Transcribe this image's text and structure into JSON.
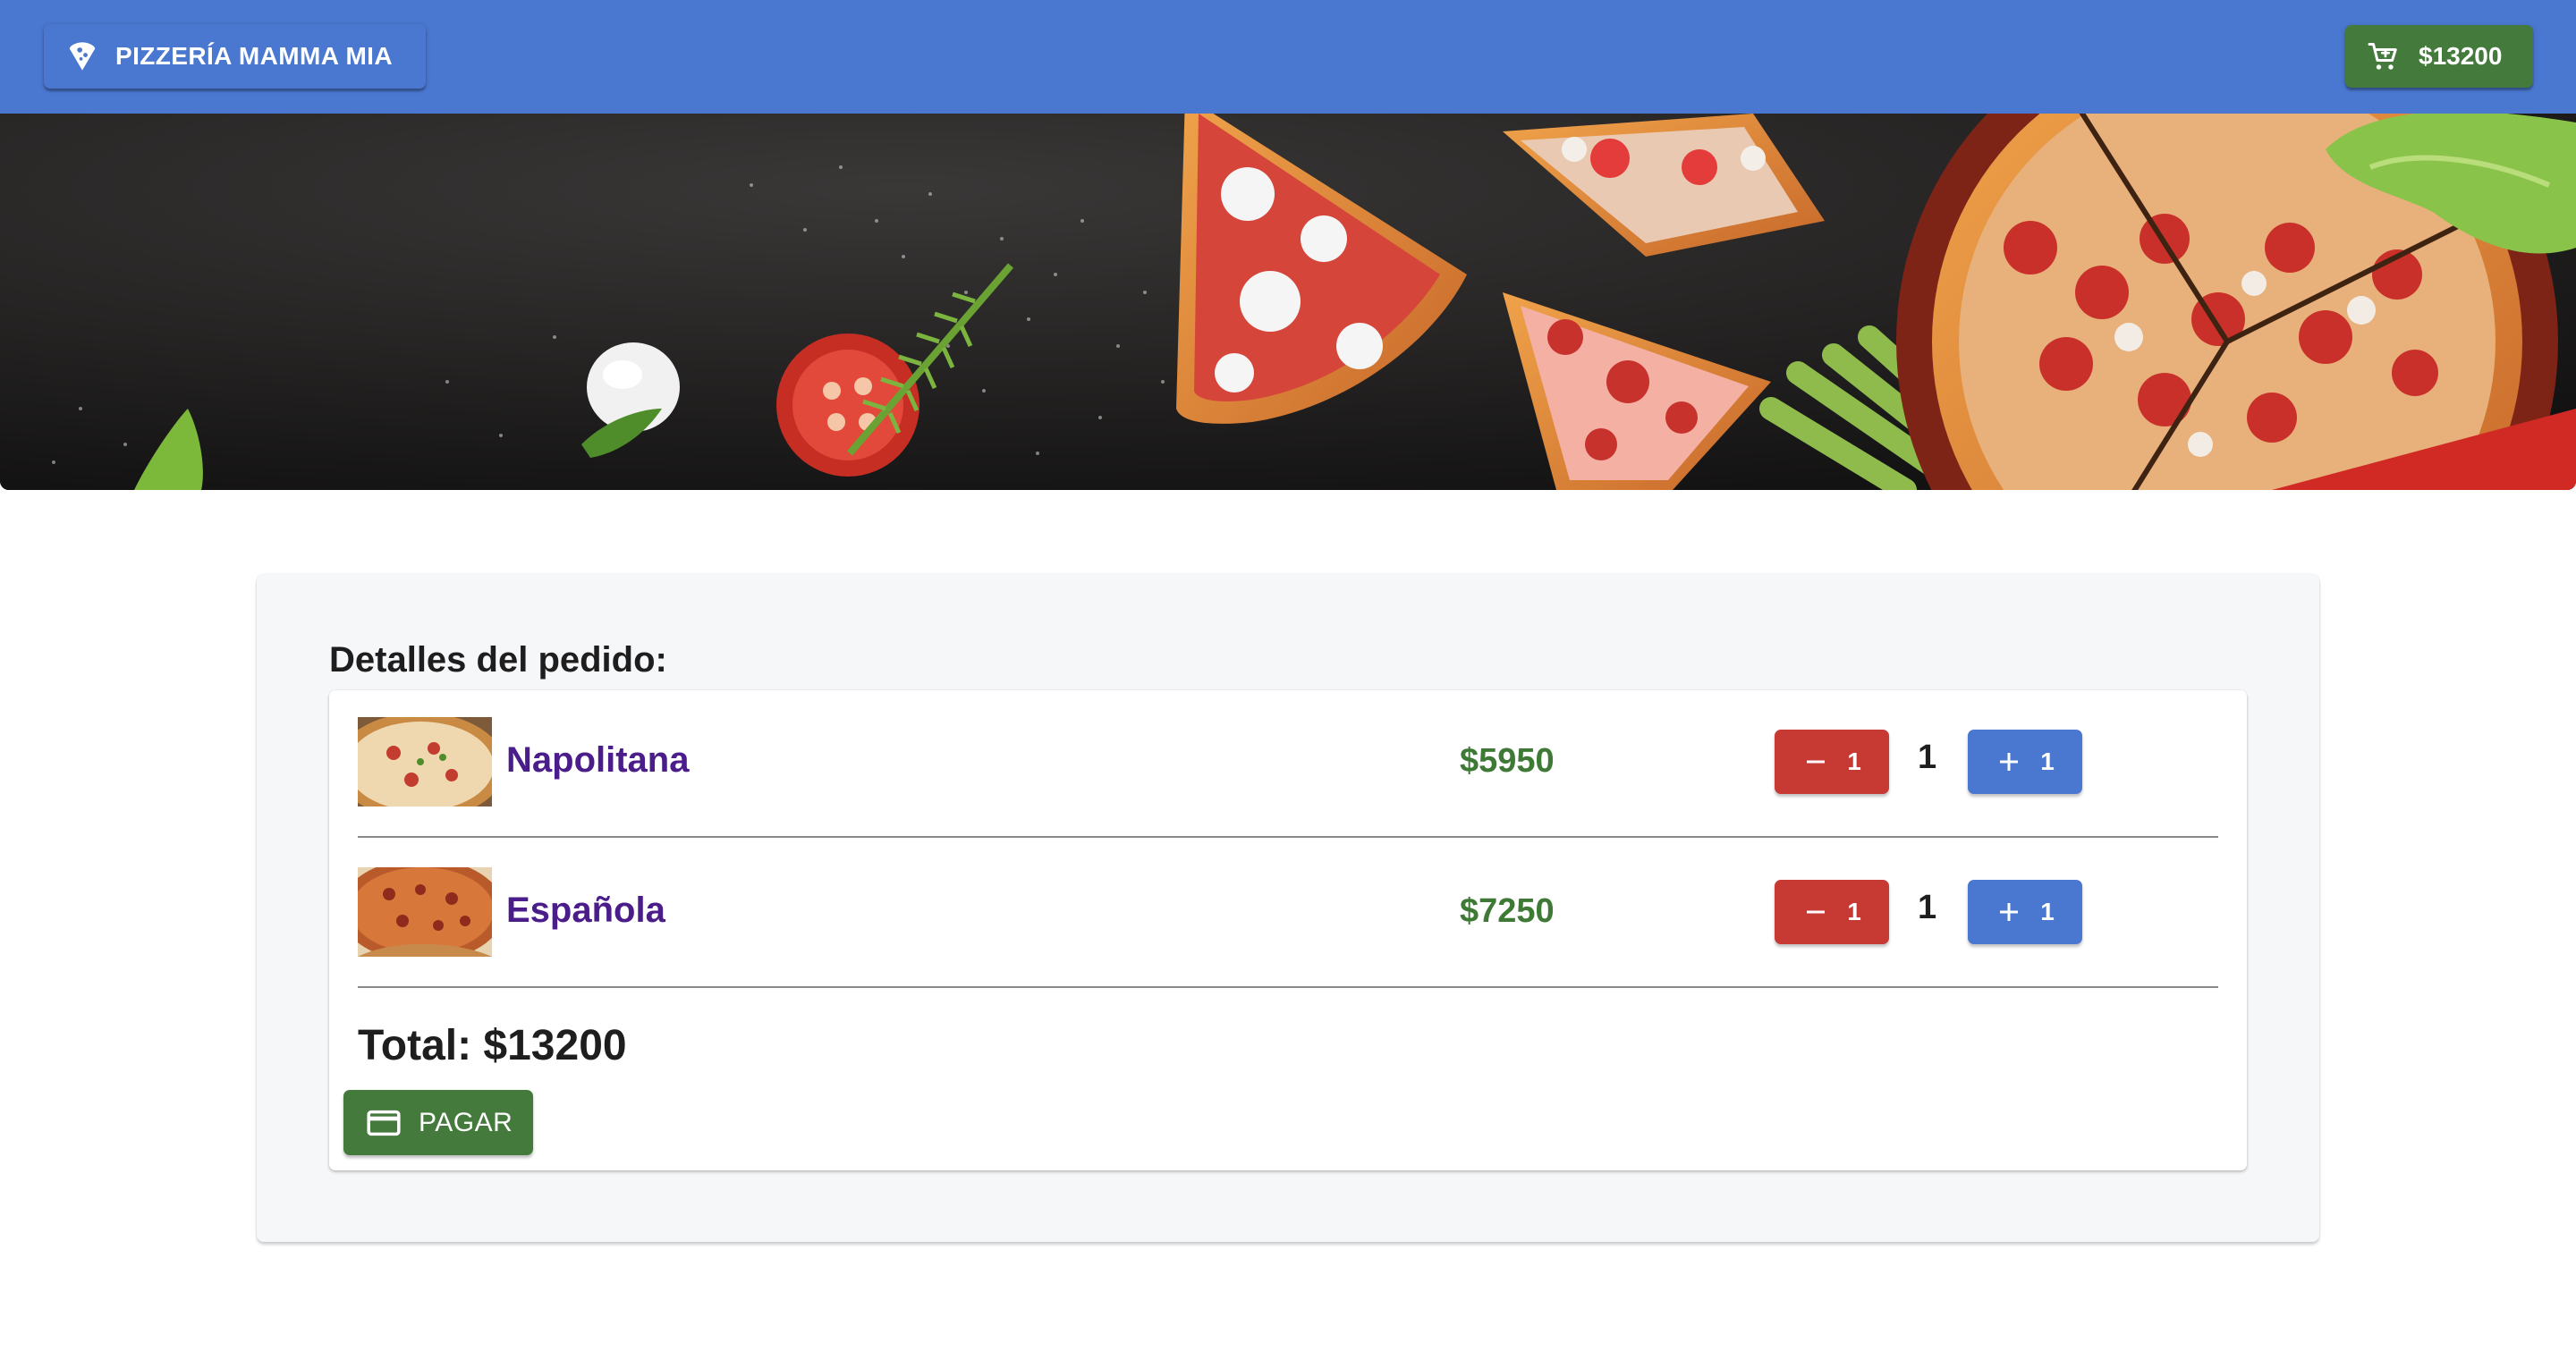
{
  "header": {
    "brand_label": "PIZZERÍA MAMMA MIA",
    "brand_icon": "pizza-slice-icon",
    "cart_icon": "cart-icon",
    "cart_total": "$13200",
    "bar_color": "#4a77cf",
    "cart_color": "#447a3c"
  },
  "hero": {
    "image": "pizza-banner"
  },
  "order": {
    "heading": "Detalles del pedido:",
    "items": [
      {
        "name": "Napolitana",
        "price": "$5950",
        "quantity": "1",
        "decrement_label": "1",
        "increment_label": "1"
      },
      {
        "name": "Española",
        "price": "$7250",
        "quantity": "1",
        "decrement_label": "1",
        "increment_label": "1"
      }
    ],
    "total": "Total: $13200",
    "pay_label": "PAGAR",
    "pay_icon": "credit-card-icon"
  },
  "colors": {
    "minus_button": "#c63a33",
    "plus_button": "#4a77cf",
    "item_name": "#4a1d8a",
    "price": "#3e7a36"
  }
}
